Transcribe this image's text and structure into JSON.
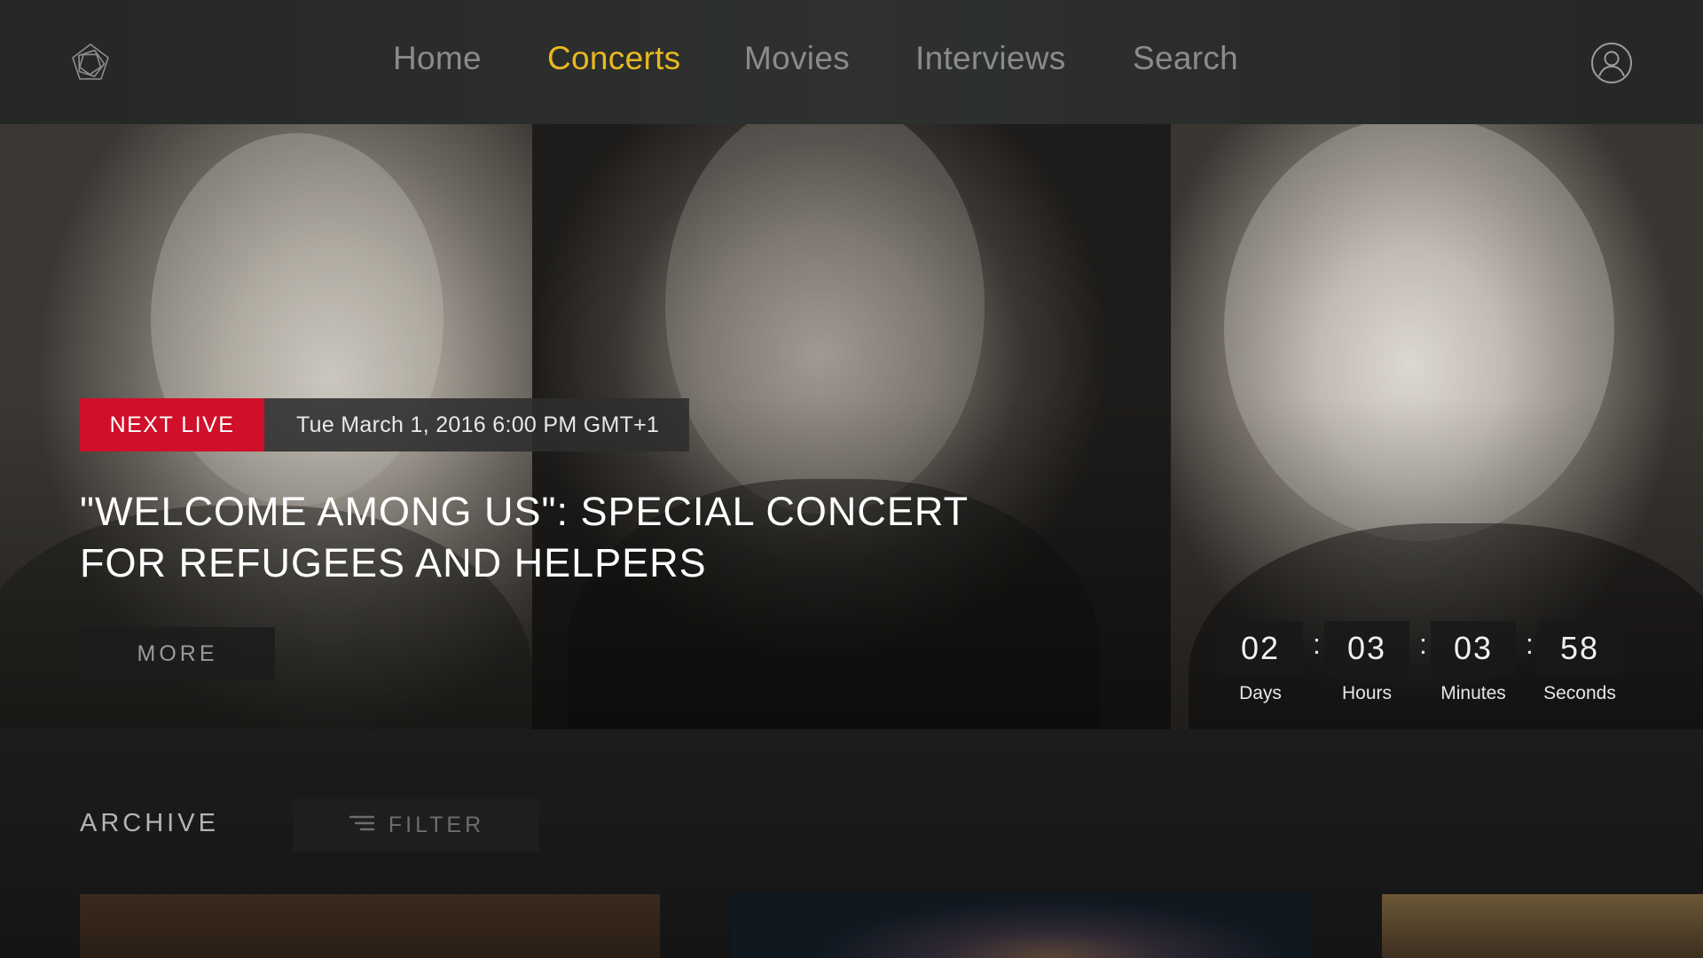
{
  "nav": {
    "items": [
      {
        "label": "Home"
      },
      {
        "label": "Concerts"
      },
      {
        "label": "Movies"
      },
      {
        "label": "Interviews"
      },
      {
        "label": "Search"
      }
    ],
    "active": "Concerts",
    "active_color": "#e8b91f"
  },
  "icons": {
    "logo": "pentagon-logo-icon",
    "profile": "user-profile-icon",
    "filter": "filter-lines-icon"
  },
  "hero": {
    "badge": "NEXT LIVE",
    "badge_color": "#d0102a",
    "date": "Tue  March 1, 2016  6:00 PM GMT+1",
    "title_line1": "\"WELCOME AMONG US\": SPECIAL CONCERT",
    "title_line2": "FOR REFUGEES AND HELPERS",
    "more_label": "MORE"
  },
  "countdown": {
    "days": {
      "value": "02",
      "label": "Days"
    },
    "hours": {
      "value": "03",
      "label": "Hours"
    },
    "minutes": {
      "value": "03",
      "label": "Minutes"
    },
    "seconds": {
      "value": "58",
      "label": "Seconds"
    },
    "separator": ":"
  },
  "archive": {
    "title": "ARCHIVE",
    "filter_label": "FILTER"
  }
}
